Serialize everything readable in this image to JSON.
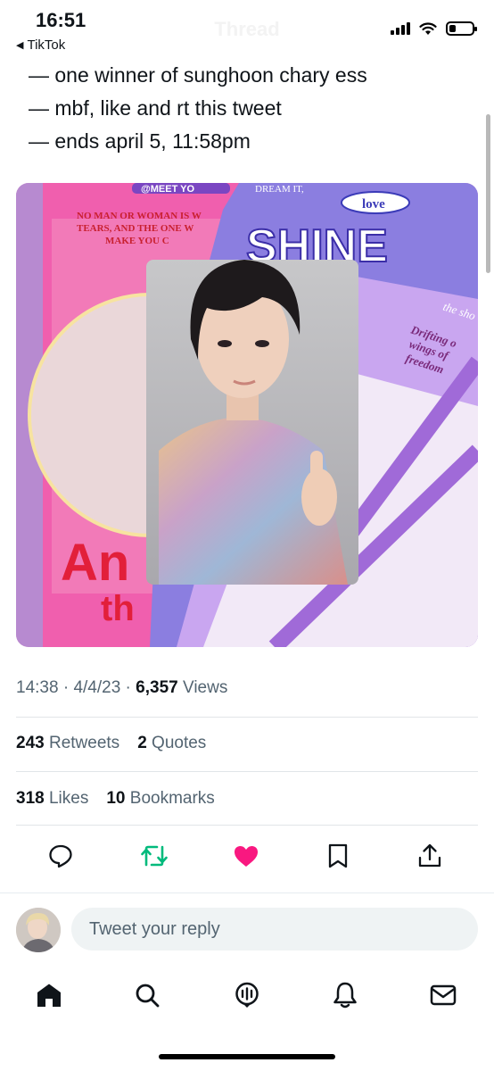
{
  "status_bar": {
    "time": "16:51",
    "back_app": "TikTok",
    "ghost_title": "Thread"
  },
  "tweet": {
    "lines": [
      "— one winner of sunghoon chary ess",
      "— mbf, like and rt this tweet",
      "— ends april 5, 11:58pm"
    ],
    "photo_texts": {
      "handle_banner": "@MEET YO",
      "quote_line1": "NO MAN OR WOMAN IS W",
      "quote_line2": "TEARS, AND THE ONE W",
      "quote_line3": "MAKE YOU C",
      "dream": "DREAM IT,",
      "love": "love",
      "shine": "SHINE",
      "drifting_line1": "Drifting o",
      "drifting_line2": "wings of",
      "drifting_line3": "freedom",
      "the_sho": "the sho",
      "ann": "An",
      "th": "th"
    }
  },
  "meta": {
    "time": "14:38",
    "separator": "·",
    "date": "4/4/23",
    "views_count": "6,357",
    "views_label": "Views"
  },
  "stats": {
    "retweets_count": "243",
    "retweets_label": "Retweets",
    "quotes_count": "2",
    "quotes_label": "Quotes",
    "likes_count": "318",
    "likes_label": "Likes",
    "bookmarks_count": "10",
    "bookmarks_label": "Bookmarks"
  },
  "actions": [
    {
      "icon": "reply-icon"
    },
    {
      "icon": "retweet-icon",
      "color": "#00ba7c"
    },
    {
      "icon": "like-icon",
      "color": "#f91880"
    },
    {
      "icon": "bookmark-icon"
    },
    {
      "icon": "share-icon"
    }
  ],
  "reply": {
    "placeholder": "Tweet your reply"
  },
  "tabbar": [
    "home-icon",
    "search-icon",
    "spaces-icon",
    "notifications-icon",
    "messages-icon"
  ],
  "colors": {
    "text": "#0f1419",
    "muted": "#536471",
    "retweet": "#00ba7c",
    "like": "#f91880"
  }
}
